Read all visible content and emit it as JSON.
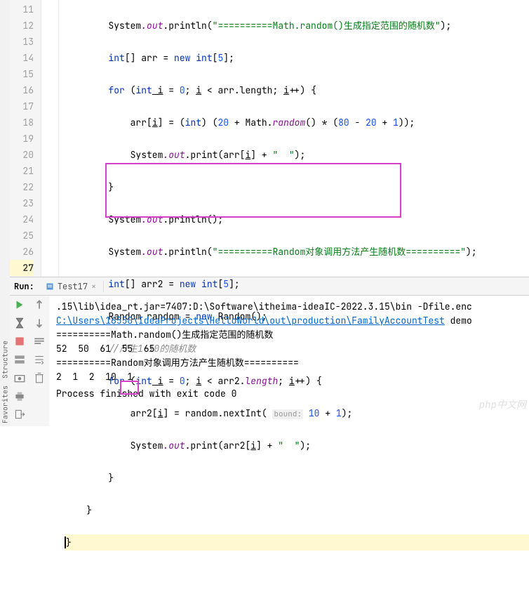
{
  "lineNumbers": [
    "11",
    "12",
    "13",
    "14",
    "15",
    "16",
    "17",
    "18",
    "19",
    "20",
    "21",
    "22",
    "23",
    "24",
    "25",
    "26",
    "27"
  ],
  "code": {
    "l11_class": "System",
    "l11_field": ".out",
    "l11_mtd": ".println",
    "l11_paren_open": "(",
    "l11_str": "\"==========Math.random()生成指定范围的随机数\"",
    "l11_paren_close": ");",
    "l12_kw1": "int",
    "l12_brackets": "[] ",
    "l12_var": "arr",
    "l12_eq": " = ",
    "l12_kw2": "new int",
    "l12_arr": "[",
    "l12_num": "5",
    "l12_end": "];",
    "l13_kw": "for",
    "l13_open": " (",
    "l13_kw2": "int",
    "l13_var": " i",
    "l13_init": " = ",
    "l13_zero": "0",
    "l13_sep": "; ",
    "l13_var2": "i",
    "l13_lt": " < arr.length; ",
    "l13_var3": "i",
    "l13_inc": "++) {",
    "l14_lhs": "arr[",
    "l14_i": "i",
    "l14_rhs": "] = (",
    "l14_cast": "int",
    "l14_rest": ") (",
    "l14_n1": "20",
    "l14_plus": " + Math.",
    "l14_rnd": "random",
    "l14_mul": "() * (",
    "l14_n2": "80",
    "l14_minus": " - ",
    "l14_n3": "20",
    "l14_plus2": " + ",
    "l14_n4": "1",
    "l14_end": "));",
    "l15_sys": "System",
    "l15_out": ".out",
    "l15_print": ".print",
    "l15_open": "(arr[",
    "l15_i": "i",
    "l15_close": "] + ",
    "l15_str": "\"  \"",
    "l15_end": ");",
    "l16": "}",
    "l17_sys": "System",
    "l17_out": ".out",
    "l17_println": ".println",
    "l17_end": "();",
    "l18_sys": "System",
    "l18_out": ".out",
    "l18_println": ".println",
    "l18_open": "(",
    "l18_str": "\"==========Random对象调用方法产生随机数==========\"",
    "l18_end": ");",
    "l19_kw": "int",
    "l19_br": "[] ",
    "l19_var": "arr2",
    "l19_eq": " = ",
    "l19_kw2": "new int",
    "l19_ob": "[",
    "l19_num": "5",
    "l19_end": "];",
    "l20_cls": "Random ",
    "l20_var": "random",
    "l20_eq": " = ",
    "l20_kw": "new",
    "l20_ctor": " Random();",
    "l21": "//产生1-10的随机数",
    "l22_kw": "for",
    "l22_open": " (",
    "l22_kw2": "int",
    "l22_i": " i",
    "l22_init": " = ",
    "l22_zero": "0",
    "l22_sep": "; ",
    "l22_i2": "i",
    "l22_cond": " < arr2.",
    "l22_len": "length",
    "l22_sep2": "; ",
    "l22_i3": "i",
    "l22_inc": "++) {",
    "l23_lhs": "arr2[",
    "l23_i": "i",
    "l23_rhs": "] = random.nextInt( ",
    "l23_hint": "bound:",
    "l23_sp": " ",
    "l23_n1": "10",
    "l23_plus": " + ",
    "l23_n2": "1",
    "l23_end": ");",
    "l24_sys": "System",
    "l24_out": ".out",
    "l24_print": ".print",
    "l24_open": "(arr2[",
    "l24_i": "i",
    "l24_close": "] + ",
    "l24_str": "\"  \"",
    "l24_end": ");",
    "l25": "}",
    "l26": "}",
    "l27": "}"
  },
  "run": {
    "label": "Run:",
    "tab": "Test17",
    "line1_a": ".15\\lib\\idea_rt.jar=7407:D:\\Software\\itheima-ideaIC-2022.3.15\\bin -Dfile.enc",
    "line2_link": "C:\\Users\\16550\\IdeaProjects\\HelloWorld\\out\\production\\FamilyAccountTest",
    "line2_b": " demo",
    "line3": "==========Math.random()生成指定范围的随机数",
    "line4": "52  50  61  55  65  ",
    "line5": "==========Random对象调用方法产生随机数==========",
    "line6": "2  1  2  10  1  ",
    "line7": "Process finished with exit code 0"
  },
  "sidebar": {
    "structure": "Structure",
    "favorites": "Favorites"
  },
  "watermark": "php中文网"
}
